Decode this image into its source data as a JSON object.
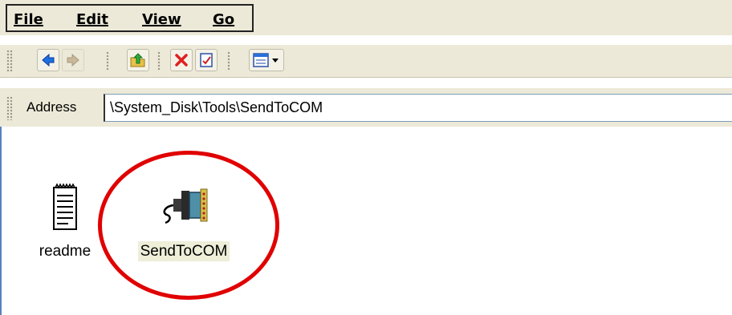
{
  "menu": {
    "file": "File",
    "edit": "Edit",
    "view": "View",
    "go": "Go"
  },
  "toolbar": {
    "buttons": [
      "back-icon",
      "forward-icon",
      "up-folder-icon",
      "delete-icon",
      "properties-icon",
      "view-mode-icon"
    ]
  },
  "address": {
    "label": "Address",
    "value": "\\System_Disk\\Tools\\SendToCOM"
  },
  "files": [
    {
      "name": "readme",
      "icon": "text-document-icon",
      "selected": false
    },
    {
      "name": "SendToCOM",
      "icon": "serial-cable-icon",
      "selected": true
    }
  ],
  "annotation": {
    "color": "#e00000",
    "shape": "circle",
    "target": "SendToCOM"
  }
}
